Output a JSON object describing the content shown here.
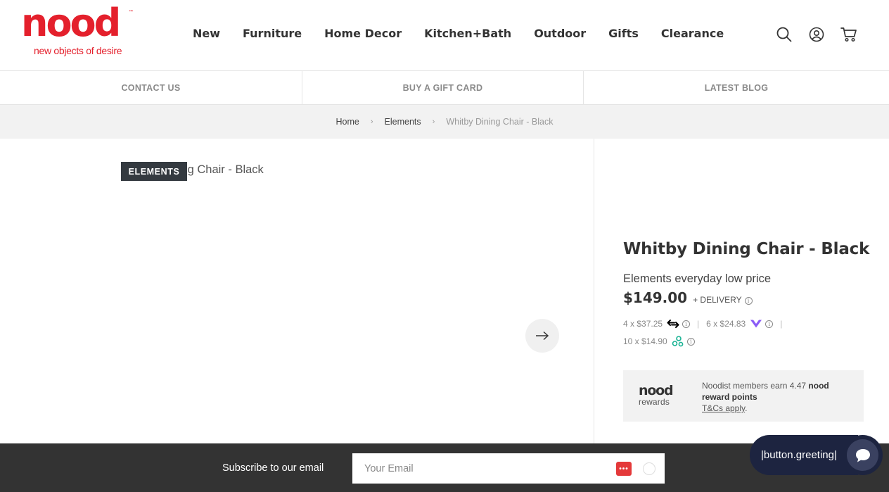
{
  "logo": {
    "word": "nood",
    "tagline": "new objects of desire",
    "tm": "™"
  },
  "nav": {
    "items": [
      "New",
      "Furniture",
      "Home Decor",
      "Kitchen+Bath",
      "Outdoor",
      "Gifts",
      "Clearance"
    ]
  },
  "header_icons": [
    "search-icon",
    "account-icon",
    "cart-icon"
  ],
  "subbar": {
    "contact": "CONTACT US",
    "gift_card": "BUY A GIFT CARD",
    "blog": "LATEST BLOG"
  },
  "breadcrumb": {
    "home": "Home",
    "category": "Elements",
    "current": "Whitby Dining Chair - Black",
    "separator": "›"
  },
  "gallery": {
    "badge": "ELEMENTS",
    "image_title": "Whitby Dining Chair - Black"
  },
  "product": {
    "title": "Whitby Dining Chair - Black",
    "subtitle": "Elements everyday low price",
    "price": "$149.00",
    "delivery": "+ DELIVERY",
    "installments": [
      {
        "text": "4 x $37.25",
        "provider_icon": "afterpay-icon",
        "color": "#000000"
      },
      {
        "text": "6 x $24.83",
        "provider_icon": "zip-icon",
        "color": "#8b5cf6"
      },
      {
        "text": "10 x $14.90",
        "provider_icon": "latitude-icon",
        "color": "#1ab394"
      }
    ],
    "separator": "|"
  },
  "rewards": {
    "logo_word": "nood",
    "logo_sub": "rewards",
    "text_prefix": "Noodist members earn 4.47 ",
    "text_bold": "nood reward points",
    "link": "T&Cs apply",
    "link_suffix": "."
  },
  "subscribe": {
    "label": "Subscribe to our email",
    "placeholder": "Your Email",
    "pw_icon_text": "•••"
  },
  "chat": {
    "greeting": "|button.greeting|"
  },
  "colors": {
    "brand_red": "#e4202c",
    "footer_bg": "#333333",
    "chat_bg": "#1d2440"
  }
}
